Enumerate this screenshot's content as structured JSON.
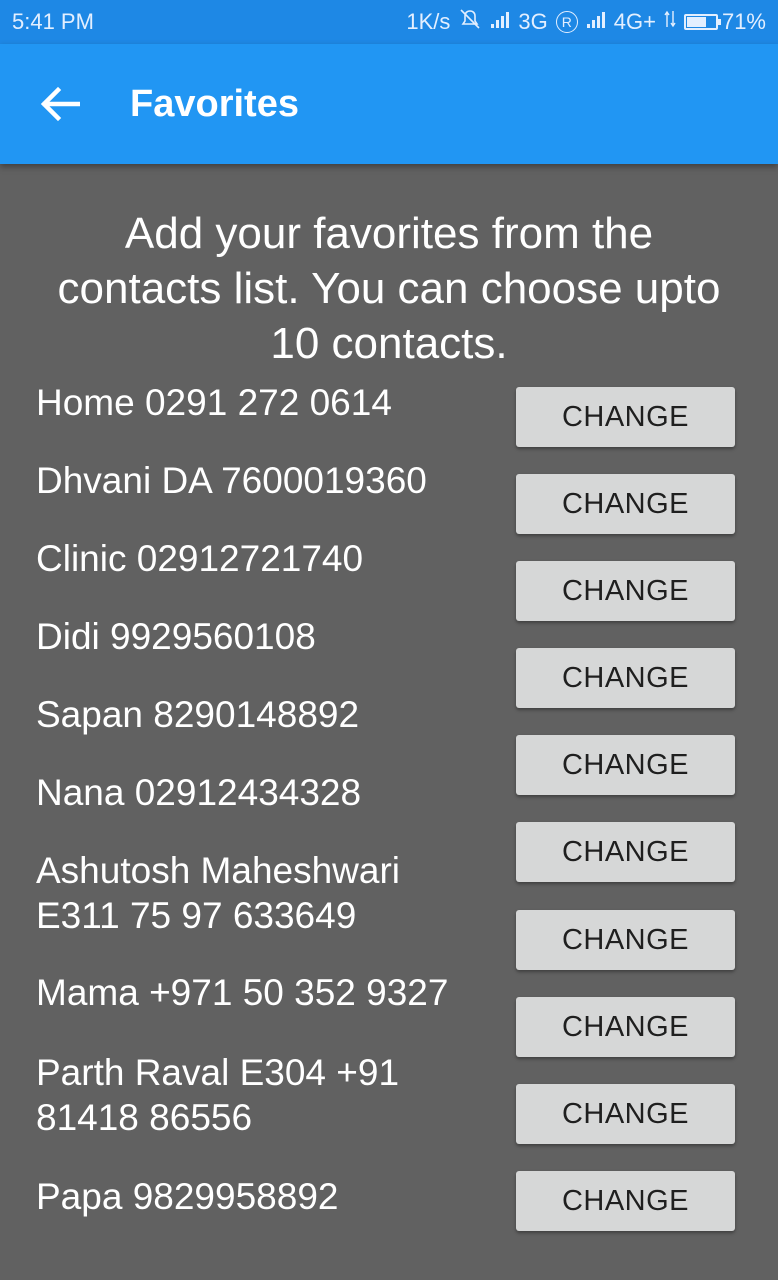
{
  "status_bar": {
    "time": "5:41 PM",
    "net_speed": "1K/s",
    "sim1_network": "3G",
    "roaming_mark": "R",
    "sim2_network": "4G+",
    "battery_percent": "71%",
    "battery_level": 0.71
  },
  "app_bar": {
    "title": "Favorites",
    "back_icon": "arrow-back-icon",
    "background": "#2196f3"
  },
  "intro_text": "Add your favorites from the contacts list. You can choose upto 10 contacts.",
  "favorites": [
    {
      "label": "Home 0291 272 0614",
      "button": "CHANGE"
    },
    {
      "label": "Dhvani DA 7600019360",
      "button": "CHANGE"
    },
    {
      "label": "Clinic 02912721740",
      "button": "CHANGE"
    },
    {
      "label": "Didi 9929560108",
      "button": "CHANGE"
    },
    {
      "label": "Sapan 8290148892",
      "button": "CHANGE"
    },
    {
      "label": "Nana 02912434328",
      "button": "CHANGE"
    },
    {
      "label": "Ashutosh Maheshwari E311 75 97 633649",
      "button": "CHANGE"
    },
    {
      "label": "Mama +971 50 352 9327",
      "button": "CHANGE"
    },
    {
      "label": "Parth Raval E304 +91 81418 86556",
      "button": "CHANGE"
    },
    {
      "label": "Papa 9829958892",
      "button": "CHANGE"
    }
  ],
  "colors": {
    "page_background": "#616161",
    "button_background": "#d6d7d7",
    "status_bar": "#1e88e5"
  }
}
